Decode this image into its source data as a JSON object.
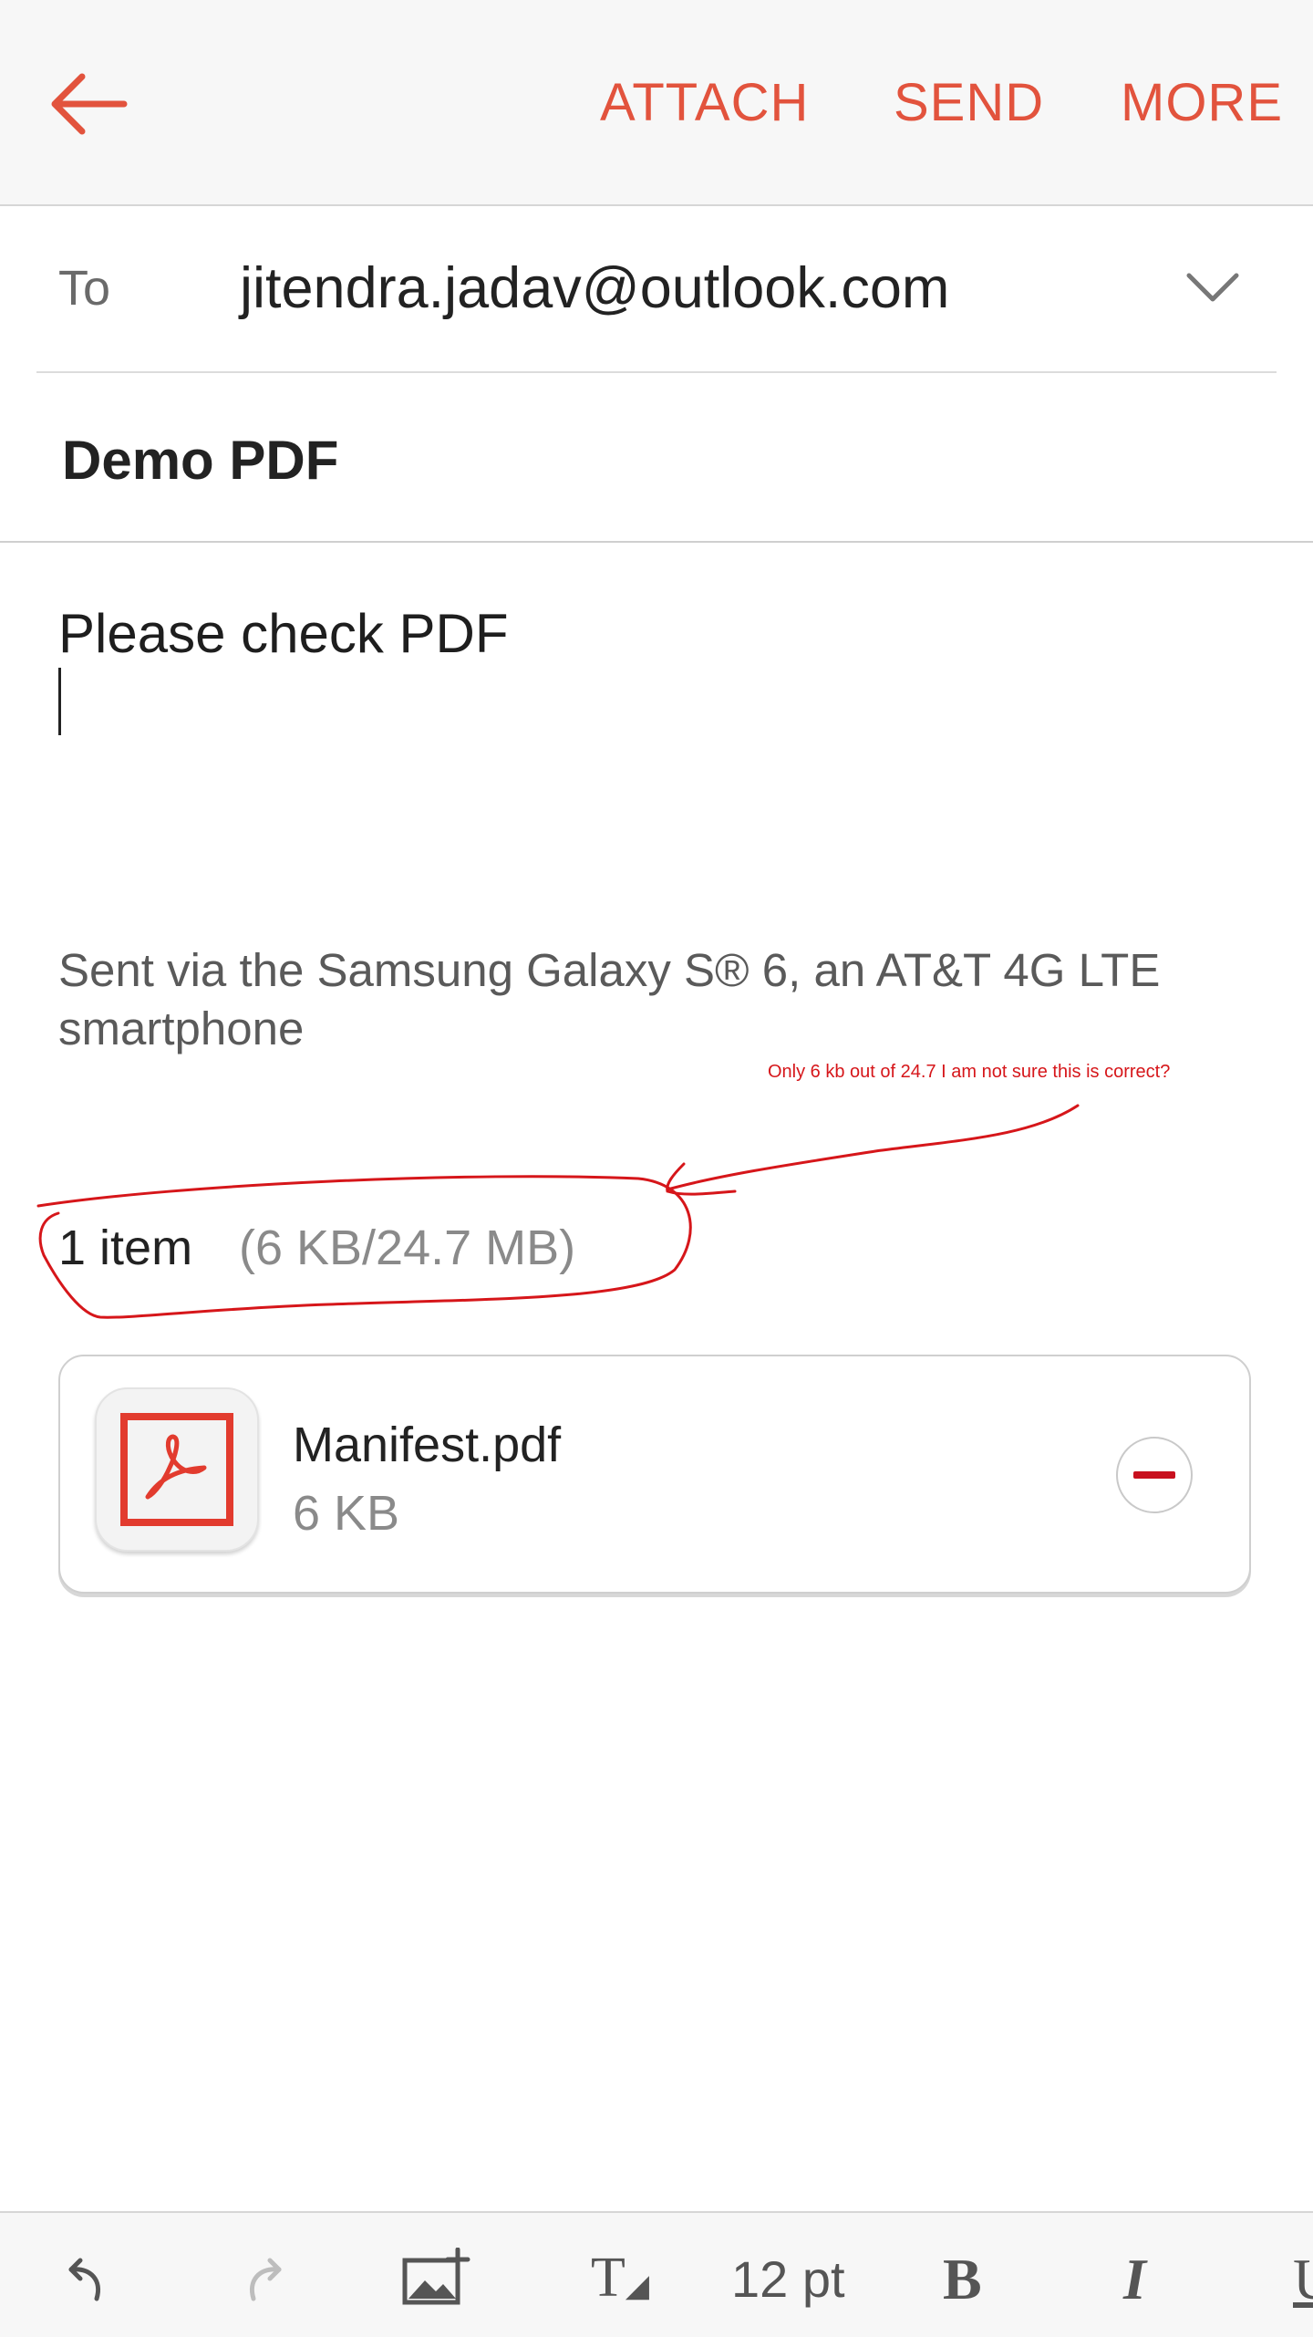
{
  "header": {
    "back_icon": "arrow-left-icon",
    "actions": [
      "ATTACH",
      "SEND",
      "MORE"
    ]
  },
  "compose": {
    "to_label": "To",
    "to_value": "jitendra.jadav@outlook.com",
    "subject": "Demo PDF",
    "body": "Please check PDF",
    "signature": "Sent via the Samsung Galaxy S® 6, an AT&T 4G LTE smartphone"
  },
  "annotation": {
    "text": "Only 6 kb out of 24.7 I am not sure this is correct?"
  },
  "attachments": {
    "count_label": "1 item",
    "size_summary": "(6 KB/24.7 MB)",
    "items": [
      {
        "name": "Manifest.pdf",
        "size": "6 KB",
        "icon": "pdf-icon"
      }
    ]
  },
  "toolbar": {
    "font_size": "12 pt",
    "icons": [
      "undo-icon",
      "redo-icon",
      "insert-image-icon",
      "text-style-icon",
      "bold-icon",
      "italic-icon",
      "underline-icon"
    ]
  },
  "colors": {
    "accent": "#e2533d",
    "annotation": "#d6161a",
    "remove": "#c8101e"
  }
}
